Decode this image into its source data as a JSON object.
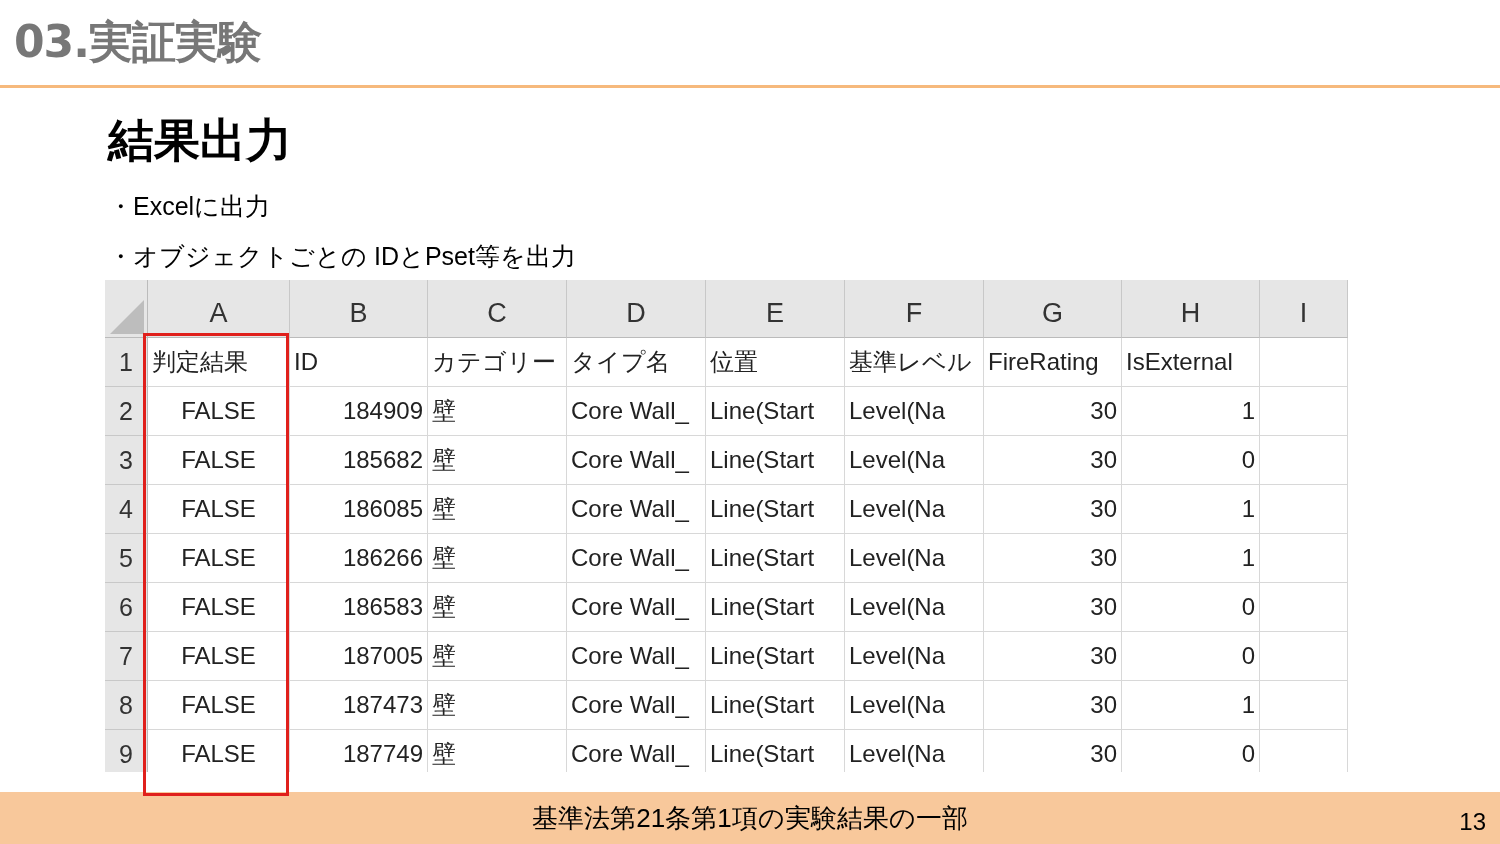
{
  "slide": {
    "section_title": "03.実証実験",
    "heading": "結果出力",
    "bullets": [
      "・Excelに出力",
      "・オブジェクトごとの IDとPset等を出力"
    ],
    "caption": "基準法第21条第1項の実験結果の一部",
    "page_number": "13"
  },
  "sheet": {
    "columns": [
      {
        "label": "A",
        "highlighted": true
      },
      {
        "label": "B",
        "highlighted": false
      },
      {
        "label": "C",
        "highlighted": false
      },
      {
        "label": "D",
        "highlighted": false
      },
      {
        "label": "E",
        "highlighted": false
      },
      {
        "label": "F",
        "highlighted": false
      },
      {
        "label": "G",
        "highlighted": false
      },
      {
        "label": "H",
        "highlighted": false
      },
      {
        "label": "I",
        "highlighted": false
      }
    ],
    "rows": [
      {
        "number": "1",
        "cells": [
          {
            "kind": "text",
            "value": "判定結果"
          },
          {
            "kind": "text",
            "value": "ID"
          },
          {
            "kind": "text",
            "value": "カテゴリー"
          },
          {
            "kind": "text",
            "value": "タイプ名"
          },
          {
            "kind": "text",
            "value": "位置"
          },
          {
            "kind": "text",
            "value": "基準レベル"
          },
          {
            "kind": "text",
            "value": "FireRating"
          },
          {
            "kind": "text",
            "value": "IsExternal"
          }
        ]
      },
      {
        "number": "2",
        "cells": [
          {
            "kind": "bool",
            "value": "FALSE"
          },
          {
            "kind": "number",
            "value": "184909"
          },
          {
            "kind": "text",
            "value": "壁"
          },
          {
            "kind": "text",
            "value": "Core Wall_"
          },
          {
            "kind": "text",
            "value": "Line(Start"
          },
          {
            "kind": "text",
            "value": "Level(Na"
          },
          {
            "kind": "number",
            "value": "30"
          },
          {
            "kind": "number",
            "value": "1"
          }
        ]
      },
      {
        "number": "3",
        "cells": [
          {
            "kind": "bool",
            "value": "FALSE"
          },
          {
            "kind": "number",
            "value": "185682"
          },
          {
            "kind": "text",
            "value": "壁"
          },
          {
            "kind": "text",
            "value": "Core Wall_"
          },
          {
            "kind": "text",
            "value": "Line(Start"
          },
          {
            "kind": "text",
            "value": "Level(Na"
          },
          {
            "kind": "number",
            "value": "30"
          },
          {
            "kind": "number",
            "value": "0"
          }
        ]
      },
      {
        "number": "4",
        "cells": [
          {
            "kind": "bool",
            "value": "FALSE"
          },
          {
            "kind": "number",
            "value": "186085"
          },
          {
            "kind": "text",
            "value": "壁"
          },
          {
            "kind": "text",
            "value": "Core Wall_"
          },
          {
            "kind": "text",
            "value": "Line(Start"
          },
          {
            "kind": "text",
            "value": "Level(Na"
          },
          {
            "kind": "number",
            "value": "30"
          },
          {
            "kind": "number",
            "value": "1"
          }
        ]
      },
      {
        "number": "5",
        "cells": [
          {
            "kind": "bool",
            "value": "FALSE"
          },
          {
            "kind": "number",
            "value": "186266"
          },
          {
            "kind": "text",
            "value": "壁"
          },
          {
            "kind": "text",
            "value": "Core Wall_"
          },
          {
            "kind": "text",
            "value": "Line(Start"
          },
          {
            "kind": "text",
            "value": "Level(Na"
          },
          {
            "kind": "number",
            "value": "30"
          },
          {
            "kind": "number",
            "value": "1"
          }
        ]
      },
      {
        "number": "6",
        "cells": [
          {
            "kind": "bool",
            "value": "FALSE"
          },
          {
            "kind": "number",
            "value": "186583"
          },
          {
            "kind": "text",
            "value": "壁"
          },
          {
            "kind": "text",
            "value": "Core Wall_"
          },
          {
            "kind": "text",
            "value": "Line(Start"
          },
          {
            "kind": "text",
            "value": "Level(Na"
          },
          {
            "kind": "number",
            "value": "30"
          },
          {
            "kind": "number",
            "value": "0"
          }
        ]
      },
      {
        "number": "7",
        "cells": [
          {
            "kind": "bool",
            "value": "FALSE"
          },
          {
            "kind": "number",
            "value": "187005"
          },
          {
            "kind": "text",
            "value": "壁"
          },
          {
            "kind": "text",
            "value": "Core Wall_"
          },
          {
            "kind": "text",
            "value": "Line(Start"
          },
          {
            "kind": "text",
            "value": "Level(Na"
          },
          {
            "kind": "number",
            "value": "30"
          },
          {
            "kind": "number",
            "value": "0"
          }
        ]
      },
      {
        "number": "8",
        "cells": [
          {
            "kind": "bool",
            "value": "FALSE"
          },
          {
            "kind": "number",
            "value": "187473"
          },
          {
            "kind": "text",
            "value": "壁"
          },
          {
            "kind": "text",
            "value": "Core Wall_"
          },
          {
            "kind": "text",
            "value": "Line(Start"
          },
          {
            "kind": "text",
            "value": "Level(Na"
          },
          {
            "kind": "number",
            "value": "30"
          },
          {
            "kind": "number",
            "value": "1"
          }
        ]
      },
      {
        "number": "9",
        "cells": [
          {
            "kind": "bool",
            "value": "FALSE"
          },
          {
            "kind": "number",
            "value": "187749"
          },
          {
            "kind": "text",
            "value": "壁"
          },
          {
            "kind": "text",
            "value": "Core Wall_"
          },
          {
            "kind": "text",
            "value": "Line(Start"
          },
          {
            "kind": "text",
            "value": "Level(Na"
          },
          {
            "kind": "number",
            "value": "30"
          },
          {
            "kind": "number",
            "value": "0"
          }
        ]
      }
    ]
  }
}
